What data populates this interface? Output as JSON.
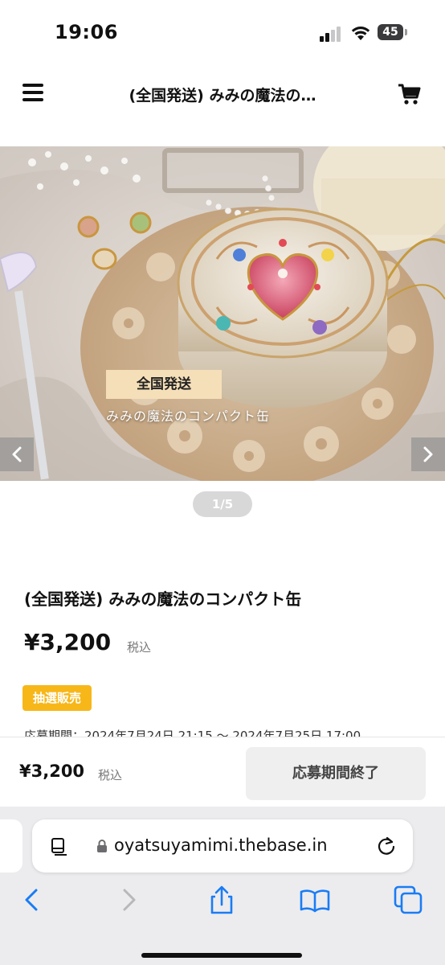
{
  "status_bar": {
    "time": "19:06",
    "battery": "45"
  },
  "header": {
    "title": "(全国発送) みみの魔法の…"
  },
  "hero": {
    "badge": "全国発送",
    "caption": "みみの魔法のコンパクト缶",
    "pager": "1/5"
  },
  "product": {
    "title": "(全国発送) みみの魔法のコンパクト缶",
    "price": "¥3,200",
    "tax_label": "税込",
    "lottery_badge": "抽選販売",
    "period": "応募期間：2024年7月24日 21:15 〜 2024年7月25日 17:00"
  },
  "buy_bar": {
    "price": "¥3,200",
    "tax_label": "税込",
    "button_label": "応募期間終了"
  },
  "browser": {
    "url": "oyatsuyamimi.thebase.in"
  },
  "colors": {
    "accent_badge": "#f7b719",
    "hero_badge": "#f5dfb9",
    "link_blue": "#1a7cf5"
  },
  "icons": [
    "menu-icon",
    "cart-icon",
    "chevron-left-icon",
    "chevron-right-icon",
    "reader-icon",
    "lock-icon",
    "reload-icon",
    "back-icon",
    "forward-icon",
    "share-icon",
    "bookmarks-icon",
    "tabs-icon"
  ]
}
